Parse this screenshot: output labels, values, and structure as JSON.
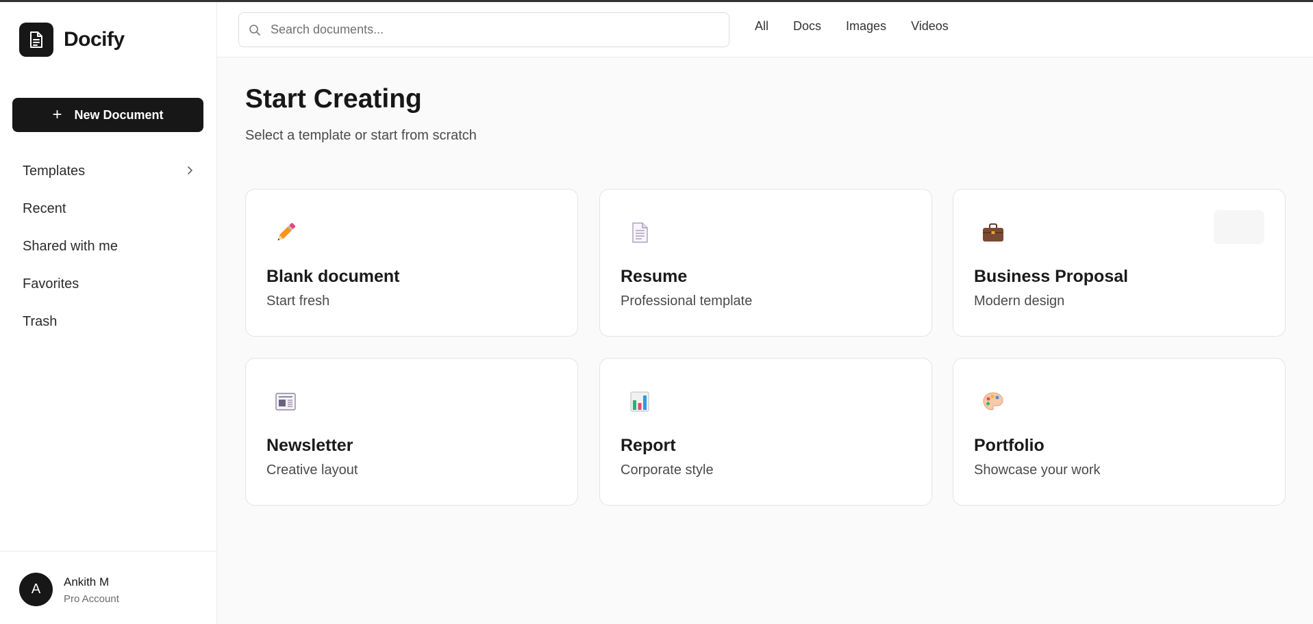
{
  "app": {
    "name": "Docify"
  },
  "sidebar": {
    "new_document_label": "New Document",
    "items": [
      {
        "label": "Templates",
        "icon": "chevron-right-icon"
      },
      {
        "label": "Recent"
      },
      {
        "label": "Shared with me"
      },
      {
        "label": "Favorites"
      },
      {
        "label": "Trash"
      }
    ]
  },
  "user": {
    "initial": "A",
    "name": "Ankith M",
    "plan": "Pro Account"
  },
  "search": {
    "placeholder": "Search documents...",
    "value": ""
  },
  "filters": [
    "All",
    "Docs",
    "Images",
    "Videos"
  ],
  "main": {
    "title": "Start Creating",
    "subtitle": "Select a template or start from scratch",
    "cards": [
      {
        "title": "Blank document",
        "description": "Start fresh",
        "icon": "pencil-icon"
      },
      {
        "title": "Resume",
        "description": "Professional template",
        "icon": "document-icon"
      },
      {
        "title": "Business Proposal",
        "description": "Modern design",
        "icon": "briefcase-icon"
      },
      {
        "title": "Newsletter",
        "description": "Creative layout",
        "icon": "newspaper-icon"
      },
      {
        "title": "Report",
        "description": "Corporate style",
        "icon": "bar-chart-icon"
      },
      {
        "title": "Portfolio",
        "description": "Showcase your work",
        "icon": "palette-icon"
      }
    ]
  },
  "colors": {
    "primary": "#171717",
    "background": "#fafafa",
    "surface": "#ffffff",
    "border": "#e3e3e3"
  }
}
